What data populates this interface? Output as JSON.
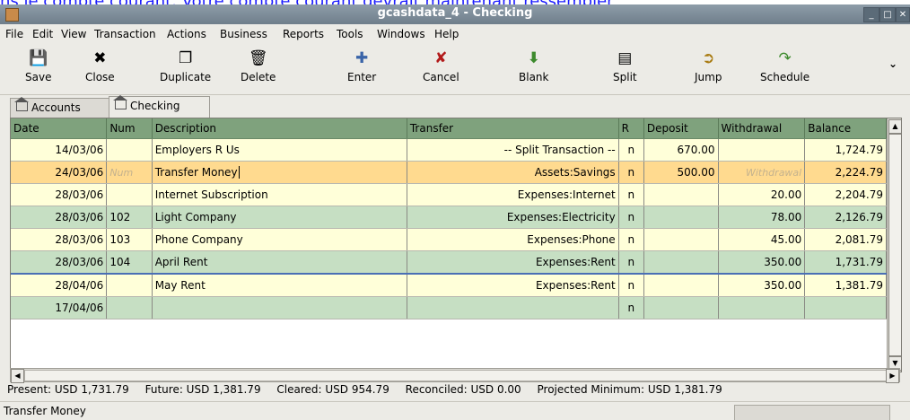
{
  "caption": "ns le compte courant. Votre compte courant devrait maintenant ressembler",
  "window": {
    "title": "gcashdata_4 - Checking",
    "minimize": "_",
    "maximize": "□",
    "close": "✕"
  },
  "menu": [
    "File",
    "Edit",
    "View",
    "Transaction",
    "Actions",
    "Business",
    "Reports",
    "Tools",
    "Windows",
    "Help"
  ],
  "toolbar": {
    "save": "Save",
    "close": "Close",
    "duplicate": "Duplicate",
    "delete": "Delete",
    "enter": "Enter",
    "cancel": "Cancel",
    "blank": "Blank",
    "split": "Split",
    "jump": "Jump",
    "schedule": "Schedule",
    "more": "⌄"
  },
  "tabs": {
    "accounts": "Accounts",
    "checking": "Checking"
  },
  "register": {
    "headers": [
      "Date",
      "Num",
      "Description",
      "Transfer",
      "R",
      "Deposit",
      "Withdrawal",
      "Balance"
    ],
    "rows": [
      {
        "date": "14/03/06",
        "num": "",
        "desc": "Employers R Us",
        "transfer": "-- Split Transaction --",
        "r": "n",
        "deposit": "670.00",
        "withdrawal": "",
        "balance": "1,724.79"
      },
      {
        "date": "24/03/06",
        "num": "Num",
        "desc": "Transfer Money",
        "transfer": "Assets:Savings",
        "r": "n",
        "deposit": "500.00",
        "withdrawal": "Withdrawal",
        "balance": "2,224.79"
      },
      {
        "date": "28/03/06",
        "num": "",
        "desc": "Internet Subscription",
        "transfer": "Expenses:Internet",
        "r": "n",
        "deposit": "",
        "withdrawal": "20.00",
        "balance": "2,204.79"
      },
      {
        "date": "28/03/06",
        "num": "102",
        "desc": "Light Company",
        "transfer": "Expenses:Electricity",
        "r": "n",
        "deposit": "",
        "withdrawal": "78.00",
        "balance": "2,126.79"
      },
      {
        "date": "28/03/06",
        "num": "103",
        "desc": "Phone Company",
        "transfer": "Expenses:Phone",
        "r": "n",
        "deposit": "",
        "withdrawal": "45.00",
        "balance": "2,081.79"
      },
      {
        "date": "28/03/06",
        "num": "104",
        "desc": "April Rent",
        "transfer": "Expenses:Rent",
        "r": "n",
        "deposit": "",
        "withdrawal": "350.00",
        "balance": "1,731.79"
      },
      {
        "date": "28/04/06",
        "num": "",
        "desc": "May Rent",
        "transfer": "Expenses:Rent",
        "r": "n",
        "deposit": "",
        "withdrawal": "350.00",
        "balance": "1,381.79"
      },
      {
        "date": "17/04/06",
        "num": "",
        "desc": "",
        "transfer": "",
        "r": "n",
        "deposit": "",
        "withdrawal": "",
        "balance": ""
      }
    ]
  },
  "summary": {
    "present": "Present: USD 1,731.79",
    "future": "Future: USD 1,381.79",
    "cleared": "Cleared: USD 954.79",
    "reconciled": "Reconciled: USD 0.00",
    "projected": "Projected Minimum: USD 1,381.79"
  },
  "status": "Transfer Money",
  "colors": {
    "header": "#7fa27d",
    "odd_row": "#ffffd9",
    "even_row": "#c6dfc3",
    "selected_row": "#ffda8f"
  }
}
